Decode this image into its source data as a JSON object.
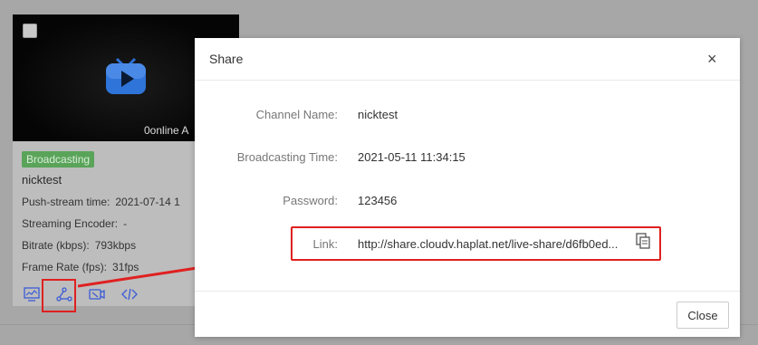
{
  "card": {
    "thumbnail_caption": "0online A",
    "status_badge": "Broadcasting",
    "name": "nicktest",
    "rows": [
      {
        "label": "Push-stream time:",
        "value": "2021-07-14 1"
      },
      {
        "label": "Streaming Encoder:",
        "value": "-"
      },
      {
        "label": "Bitrate (kbps):",
        "value": "793kbps"
      },
      {
        "label": "Frame Rate (fps):",
        "value": "31fps"
      }
    ],
    "icons": [
      "monitor-chart-icon",
      "share-icon",
      "camera-settings-icon",
      "code-icon"
    ]
  },
  "dialog": {
    "title": "Share",
    "close_glyph": "×",
    "fields": {
      "channel_name": {
        "label": "Channel Name:",
        "value": "nicktest"
      },
      "broadcasting_time": {
        "label": "Broadcasting Time:",
        "value": "2021-05-11 11:34:15"
      },
      "password": {
        "label": "Password:",
        "value": "123456"
      },
      "link": {
        "label": "Link:",
        "value": "http://share.cloudv.haplat.net/live-share/d6fb0ed..."
      }
    },
    "close_button": "Close"
  },
  "colors": {
    "highlight": "#e02020",
    "badge": "#5aa45a",
    "icon_blue": "#3a5bd6"
  }
}
